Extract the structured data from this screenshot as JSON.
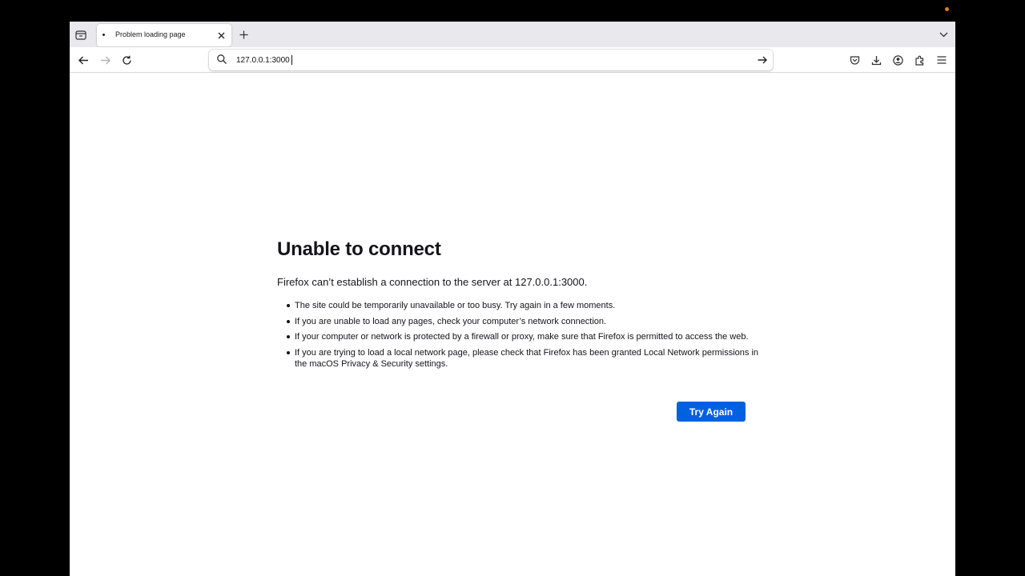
{
  "tab": {
    "title": "Problem loading page"
  },
  "urlbar": {
    "value": "127.0.0.1:3000"
  },
  "error": {
    "title": "Unable to connect",
    "description": "Firefox can’t establish a connection to the server at 127.0.0.1:3000.",
    "reasons": [
      "The site could be temporarily unavailable or too busy. Try again in a few moments.",
      "If you are unable to load any pages, check your computer’s network connection.",
      "If your computer or network is protected by a firewall or proxy, make sure that Firefox is permitted to access the web.",
      "If you are trying to load a local network page, please check that Firefox has been granted Local Network permissions in the macOS Privacy & Security settings."
    ],
    "button_label": "Try Again"
  },
  "icons": {
    "tab_list": "tab-list-icon",
    "tab_close": "close-icon",
    "new_tab": "plus-icon",
    "tab_overflow": "chevron-down-icon",
    "back": "back-arrow-icon",
    "forward": "forward-arrow-icon",
    "reload": "reload-icon",
    "search": "search-icon",
    "go": "go-arrow-icon",
    "pocket": "pocket-icon",
    "downloads": "download-icon",
    "account": "account-icon",
    "extensions": "extensions-icon",
    "menu": "hamburger-menu-icon"
  },
  "colors": {
    "primary_button": "#0061e0",
    "tabbar_bg": "#e8e8ed",
    "text": "#15141a"
  }
}
